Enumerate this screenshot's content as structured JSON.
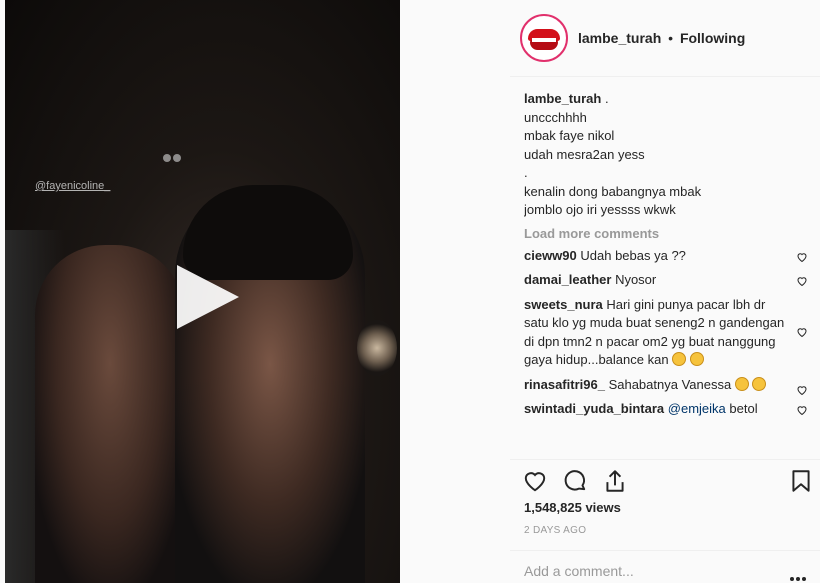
{
  "post": {
    "media_tag": "@fayenicoline_",
    "author": "lambe_turah",
    "follow_separator": "•",
    "follow_status": "Following",
    "caption_lines": [
      "unccchhhh",
      "mbak faye nikol",
      "udah mesra2an yess",
      ".",
      "kenalin dong babangnya mbak",
      "jomblo ojo iri yessss wkwk"
    ],
    "caption_first": ".",
    "load_more": "Load more comments",
    "comments": [
      {
        "user": "cieww90",
        "text": "Udah bebas ya ??"
      },
      {
        "user": "damai_leather",
        "text": "Nyosor"
      },
      {
        "user": "sweets_nura",
        "text": "Hari gini punya pacar lbh dr satu klo yg muda buat seneng2 n gandengan di dpn tmn2 n pacar om2 yg buat nanggung gaya hidup...balance kan"
      },
      {
        "user": "rinasafitri96_",
        "text": "Sahabatnya Vanessa"
      },
      {
        "user": "swintadi_yuda_bintara",
        "mention": "@emjeika",
        "text": "betol"
      }
    ],
    "views": "1,548,825 views",
    "time_ago": "2 DAYS AGO",
    "add_comment_placeholder": "Add a comment..."
  },
  "icons": [
    "play-icon",
    "heart-icon",
    "comment-icon",
    "share-icon",
    "bookmark-icon",
    "more-icon"
  ]
}
